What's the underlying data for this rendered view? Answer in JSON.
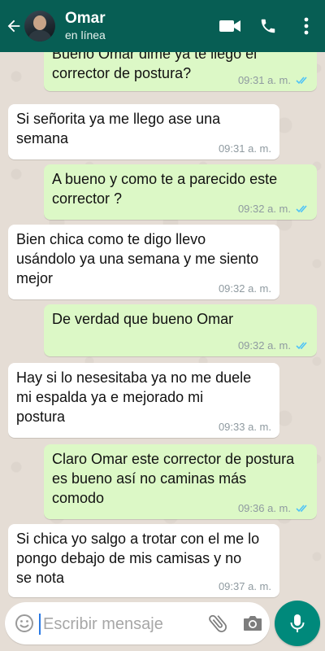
{
  "header": {
    "title": "Omar",
    "subtitle": "en línea",
    "color": "#075e54"
  },
  "messages": [
    {
      "dir": "out",
      "text": "Bueno Omar dime ya te llegó el corrector de postura?",
      "time": "09:31 a. m.",
      "read": true
    },
    {
      "dir": "in",
      "text": "Si señorita ya me llego ase una semana",
      "time": "09:31 a. m."
    },
    {
      "dir": "out",
      "text": "A bueno y como te a parecido este corrector ?",
      "time": "09:32 a. m.",
      "read": true
    },
    {
      "dir": "in",
      "text": "Bien chica como te digo llevo usándolo ya una semana y me siento mejor",
      "time": "09:32 a. m."
    },
    {
      "dir": "out",
      "text": "De verdad que bueno Omar",
      "time": "09:32 a. m.",
      "read": true
    },
    {
      "dir": "in",
      "text": "Hay si lo nesesitaba ya no me duele mi espalda ya e mejorado mi postura",
      "time": "09:33 a. m."
    },
    {
      "dir": "out",
      "text": "Claro Omar este corrector de postura es bueno así no caminas más comodo",
      "time": "09:36 a. m.",
      "read": true
    },
    {
      "dir": "in",
      "text": "Si chica yo salgo a trotar con el me lo pongo debajo de mis camisas y no se nota",
      "time": "09:37 a. m."
    }
  ],
  "composer": {
    "placeholder": "Escribir mensaje",
    "accent": "#00897b"
  },
  "icons": {
    "back": "arrow-left-icon",
    "video": "video-call-icon",
    "call": "phone-icon",
    "menu": "more-vert-icon",
    "emoji": "emoji-icon",
    "attach": "paperclip-icon",
    "camera": "camera-icon",
    "mic": "microphone-icon",
    "read": "double-check-icon"
  }
}
